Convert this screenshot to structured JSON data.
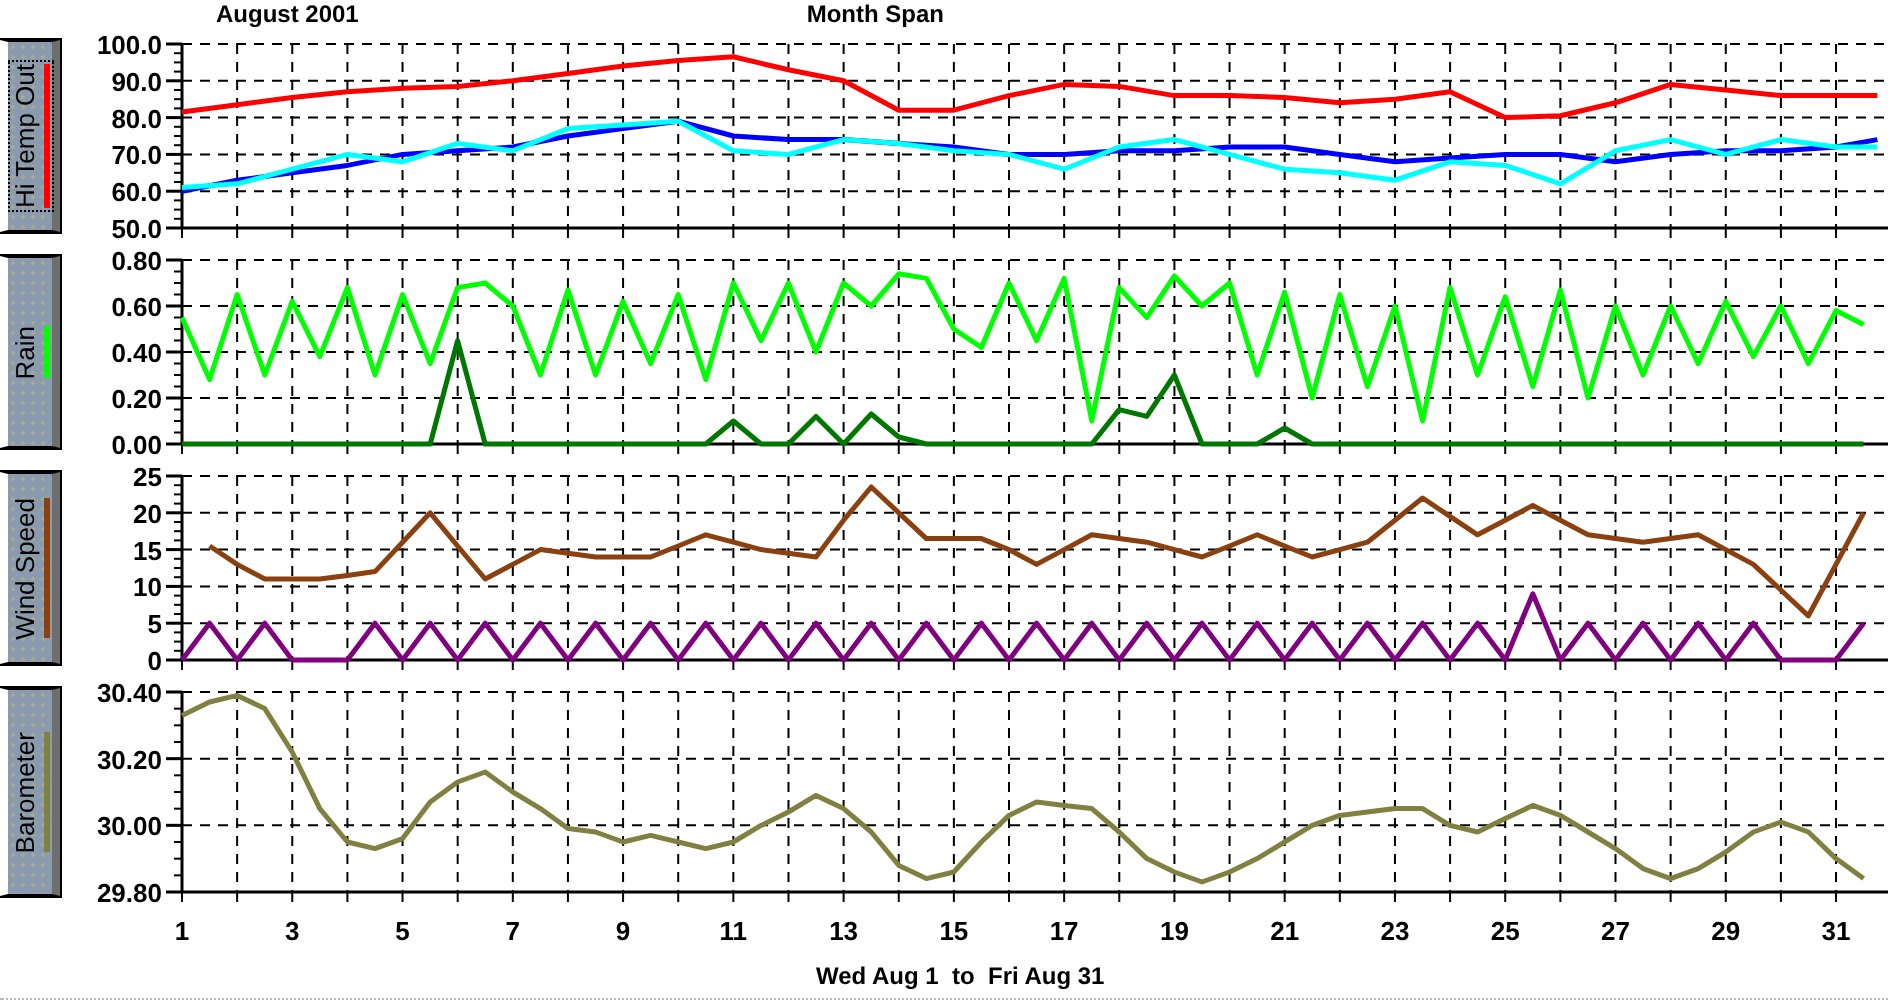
{
  "header": {
    "month": "August 2001",
    "span": "Month Span"
  },
  "panels": [
    {
      "button": {
        "label": "Hi Temp Out",
        "focused": true
      },
      "chart_data": {
        "type": "line",
        "grid": true,
        "xlim": [
          1,
          31.87
        ],
        "ylim": [
          50,
          100
        ],
        "yticks": [
          {
            "value": 50,
            "label": "50.0"
          },
          {
            "value": 60,
            "label": "60.0"
          },
          {
            "value": 70,
            "label": "70.0"
          },
          {
            "value": 80,
            "label": "80.0"
          },
          {
            "value": 90,
            "label": "90.0"
          },
          {
            "value": 100,
            "label": "100.0"
          }
        ],
        "x": [
          1,
          2,
          3,
          4,
          5,
          6,
          7,
          8,
          9,
          10,
          11,
          12,
          13,
          14,
          15,
          16,
          17,
          18,
          19,
          20,
          21,
          22,
          23,
          24,
          25,
          26,
          27,
          28,
          29,
          30,
          31,
          31.75
        ],
        "series": [
          {
            "color": "#ff0000",
            "values": [
              81.5,
              83.5,
              85.5,
              87,
              88,
              88.5,
              90,
              92,
              94,
              95.5,
              96.5,
              93,
              90,
              82,
              82,
              86,
              89,
              88.5,
              86,
              86,
              85.5,
              84,
              85,
              87,
              80,
              80.5,
              84,
              89,
              87.5,
              86,
              86,
              86
            ]
          },
          {
            "color": "#0000ff",
            "values": [
              60,
              63,
              65,
              67,
              70,
              71,
              72,
              75,
              77,
              79,
              75,
              74,
              74,
              73,
              72,
              70,
              70,
              71,
              71,
              72,
              72,
              70,
              68,
              69,
              70,
              70,
              68,
              70,
              71,
              71,
              72,
              74
            ]
          },
          {
            "color": "#00ffff",
            "values": [
              61,
              62,
              66,
              70,
              68,
              73,
              71,
              77,
              78,
              79,
              71,
              70,
              74,
              73,
              71,
              70,
              66,
              72,
              74,
              70,
              66,
              65,
              63,
              68,
              67,
              62,
              71,
              74,
              70,
              74,
              72,
              72
            ]
          }
        ]
      }
    },
    {
      "button": {
        "label": "Rain",
        "focused": false
      },
      "chart_data": {
        "type": "line",
        "grid": true,
        "xlim": [
          1,
          31.87
        ],
        "ylim": [
          0,
          0.8
        ],
        "yticks": [
          {
            "value": 0,
            "label": "0.00"
          },
          {
            "value": 0.2,
            "label": "0.20"
          },
          {
            "value": 0.4,
            "label": "0.40"
          },
          {
            "value": 0.6,
            "label": "0.60"
          },
          {
            "value": 0.8,
            "label": "0.80"
          }
        ],
        "x": [
          1,
          1.5,
          2,
          2.5,
          3,
          3.5,
          4,
          4.5,
          5,
          5.5,
          6,
          6.5,
          7,
          7.5,
          8,
          8.5,
          9,
          9.5,
          10,
          10.5,
          11,
          11.5,
          12,
          12.5,
          13,
          13.5,
          14,
          14.5,
          15,
          15.5,
          16,
          16.5,
          17,
          17.5,
          18,
          18.5,
          19,
          19.5,
          20,
          20.5,
          21,
          21.5,
          22,
          22.5,
          23,
          23.5,
          24,
          24.5,
          25,
          25.5,
          26,
          26.5,
          27,
          27.5,
          28,
          28.5,
          29,
          29.5,
          30,
          30.5,
          31,
          31.5
        ],
        "series": [
          {
            "color": "#00ff00",
            "values": [
              0.55,
              0.28,
              0.65,
              0.3,
              0.62,
              0.38,
              0.68,
              0.3,
              0.65,
              0.35,
              0.68,
              0.7,
              0.6,
              0.3,
              0.67,
              0.3,
              0.62,
              0.35,
              0.65,
              0.28,
              0.7,
              0.45,
              0.7,
              0.4,
              0.7,
              0.6,
              0.74,
              0.72,
              0.5,
              0.42,
              0.7,
              0.45,
              0.72,
              0.1,
              0.68,
              0.55,
              0.73,
              0.6,
              0.7,
              0.3,
              0.66,
              0.2,
              0.65,
              0.25,
              0.6,
              0.1,
              0.68,
              0.3,
              0.64,
              0.25,
              0.67,
              0.2,
              0.6,
              0.3,
              0.6,
              0.35,
              0.62,
              0.38,
              0.6,
              0.35,
              0.58,
              0.52
            ]
          },
          {
            "color": "#007700",
            "values": [
              0,
              0,
              0,
              0,
              0,
              0,
              0,
              0,
              0,
              0,
              0.45,
              0,
              0,
              0,
              0,
              0,
              0,
              0,
              0,
              0,
              0.1,
              0,
              0,
              0.12,
              0,
              0.13,
              0.03,
              0,
              0,
              0,
              0,
              0,
              0,
              0,
              0.15,
              0.12,
              0.3,
              0,
              0,
              0,
              0.07,
              0,
              0,
              0,
              0,
              0,
              0,
              0,
              0,
              0,
              0,
              0,
              0,
              0,
              0,
              0,
              0,
              0,
              0,
              0,
              0,
              0
            ]
          }
        ]
      }
    },
    {
      "button": {
        "label": "Wind Speed",
        "focused": false
      },
      "chart_data": {
        "type": "line",
        "grid": true,
        "xlim": [
          1,
          31.87
        ],
        "ylim": [
          0,
          25
        ],
        "yticks": [
          0,
          5,
          10,
          15,
          20,
          25
        ],
        "x": [
          1,
          1.5,
          2,
          2.5,
          3,
          3.5,
          4,
          4.5,
          5,
          5.5,
          6,
          6.5,
          7,
          7.5,
          8,
          8.5,
          9,
          9.5,
          10,
          10.5,
          11,
          11.5,
          12,
          12.5,
          13,
          13.5,
          14,
          14.5,
          15,
          15.5,
          16,
          16.5,
          17,
          17.5,
          18,
          18.5,
          19,
          19.5,
          20,
          20.5,
          21,
          21.5,
          22,
          22.5,
          23,
          23.5,
          24,
          24.5,
          25,
          25.5,
          26,
          26.5,
          27,
          27.5,
          28,
          28.5,
          29,
          29.5,
          30,
          30.5,
          31,
          31.5
        ],
        "series": [
          {
            "color": "#8b4010",
            "values": [
              null,
              15.5,
              13,
              11,
              11,
              11,
              11.5,
              12,
              16,
              20,
              15.5,
              11,
              13,
              15,
              14.5,
              14,
              14,
              14,
              15.5,
              17,
              16,
              15,
              14.5,
              14,
              19,
              23.5,
              20,
              16.5,
              16.5,
              16.5,
              15,
              13,
              15,
              17,
              16.5,
              16,
              15,
              14,
              15.5,
              17,
              15.5,
              14,
              15,
              16,
              19,
              22,
              19.5,
              17,
              19,
              21,
              19,
              17,
              16.5,
              16,
              16.5,
              17,
              15,
              13,
              9.5,
              6,
              13,
              20
            ]
          },
          {
            "color": "#800080",
            "values": [
              0,
              5,
              0,
              5,
              0,
              0,
              0,
              5,
              0,
              5,
              0,
              5,
              0,
              5,
              0,
              5,
              0,
              5,
              0,
              5,
              0,
              5,
              0,
              5,
              0,
              5,
              0,
              5,
              0,
              5,
              0,
              5,
              0,
              5,
              0,
              5,
              0,
              5,
              0,
              5,
              0,
              5,
              0,
              5,
              0,
              5,
              0,
              5,
              0,
              9,
              0,
              5,
              0,
              5,
              0,
              5,
              0,
              5,
              0,
              0,
              0,
              5
            ]
          }
        ]
      }
    },
    {
      "button": {
        "label": "Barometer",
        "focused": false
      },
      "chart_data": {
        "type": "line",
        "grid": true,
        "xlim": [
          1,
          31.87
        ],
        "ylim": [
          29.8,
          30.4
        ],
        "yticks": [
          {
            "value": 29.8,
            "label": "29.80"
          },
          {
            "value": 30,
            "label": "30.00"
          },
          {
            "value": 30.2,
            "label": "30.20"
          },
          {
            "value": 30.4,
            "label": "30.40"
          }
        ],
        "xticks": [
          1,
          3,
          5,
          7,
          9,
          11,
          13,
          15,
          17,
          19,
          21,
          23,
          25,
          27,
          29,
          31
        ],
        "x": [
          1,
          1.5,
          2,
          2.5,
          3,
          3.5,
          4,
          4.5,
          5,
          5.5,
          6,
          6.5,
          7,
          7.5,
          8,
          8.5,
          9,
          9.5,
          10,
          10.5,
          11,
          11.5,
          12,
          12.5,
          13,
          13.5,
          14,
          14.5,
          15,
          15.5,
          16,
          16.5,
          17,
          17.5,
          18,
          18.5,
          19,
          19.5,
          20,
          20.5,
          21,
          21.5,
          22,
          22.5,
          23,
          23.5,
          24,
          24.5,
          25,
          25.5,
          26,
          26.5,
          27,
          27.5,
          28,
          28.5,
          29,
          29.5,
          30,
          30.5,
          31,
          31.5
        ],
        "series": [
          {
            "color": "#808040",
            "values": [
              30.33,
              30.37,
              30.39,
              30.35,
              30.22,
              30.05,
              29.95,
              29.93,
              29.96,
              30.07,
              30.13,
              30.16,
              30.1,
              30.05,
              29.99,
              29.98,
              29.95,
              29.97,
              29.95,
              29.93,
              29.95,
              30,
              30.04,
              30.09,
              30.05,
              29.98,
              29.88,
              29.84,
              29.86,
              29.95,
              30.03,
              30.07,
              30.06,
              30.05,
              29.98,
              29.9,
              29.86,
              29.83,
              29.86,
              29.9,
              29.95,
              30,
              30.03,
              30.04,
              30.05,
              30.05,
              30,
              29.98,
              30.02,
              30.06,
              30.03,
              29.98,
              29.93,
              29.87,
              29.84,
              29.87,
              29.92,
              29.98,
              30.01,
              29.98,
              29.9,
              29.84
            ]
          }
        ]
      }
    }
  ],
  "footer": "Wed Aug 1  to  Fri Aug 31"
}
